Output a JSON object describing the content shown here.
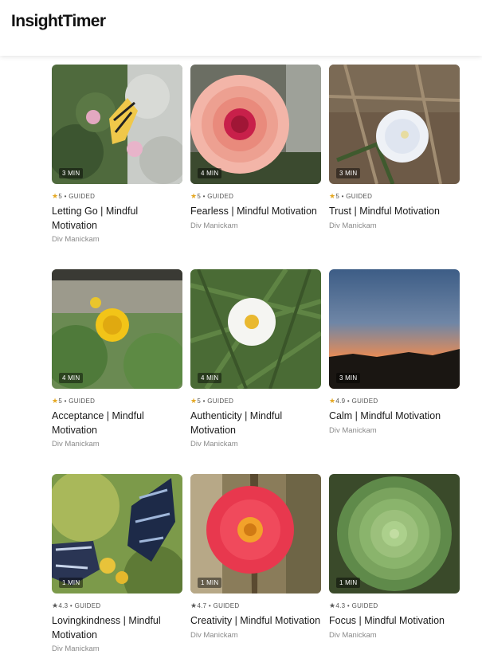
{
  "header": {
    "logo": "InsightTimer"
  },
  "cards": [
    {
      "duration": "3 MIN",
      "rating": "5",
      "type": "GUIDED",
      "title": "Letting Go | Mindful Motivation",
      "author": "Div Manickam",
      "star": "gold"
    },
    {
      "duration": "4 MIN",
      "rating": "5",
      "type": "GUIDED",
      "title": "Fearless | Mindful Motivation",
      "author": "Div Manickam",
      "star": "gold"
    },
    {
      "duration": "3 MIN",
      "rating": "5",
      "type": "GUIDED",
      "title": "Trust | Mindful Motivation",
      "author": "Div Manickam",
      "star": "gold"
    },
    {
      "duration": "4 MIN",
      "rating": "5",
      "type": "GUIDED",
      "title": "Acceptance | Mindful Motivation",
      "author": "Div Manickam",
      "star": "gold"
    },
    {
      "duration": "4 MIN",
      "rating": "5",
      "type": "GUIDED",
      "title": "Authenticity | Mindful Motivation",
      "author": "Div Manickam",
      "star": "gold"
    },
    {
      "duration": "3 MIN",
      "rating": "4.9",
      "type": "GUIDED",
      "title": "Calm | Mindful Motivation",
      "author": "Div Manickam",
      "star": "gold"
    },
    {
      "duration": "1 MIN",
      "rating": "4.3",
      "type": "GUIDED",
      "title": "Lovingkindness | Mindful Motivation",
      "author": "Div Manickam",
      "star": "grey"
    },
    {
      "duration": "1 MIN",
      "rating": "4.7",
      "type": "GUIDED",
      "title": "Creativity | Mindful Motivation",
      "author": "Div Manickam",
      "star": "grey"
    },
    {
      "duration": "1 MIN",
      "rating": "4.3",
      "type": "GUIDED",
      "title": "Focus | Mindful Motivation",
      "author": "Div Manickam",
      "star": "grey"
    }
  ],
  "colors": {
    "star_gold": "#e5a823",
    "star_grey": "#555555"
  }
}
